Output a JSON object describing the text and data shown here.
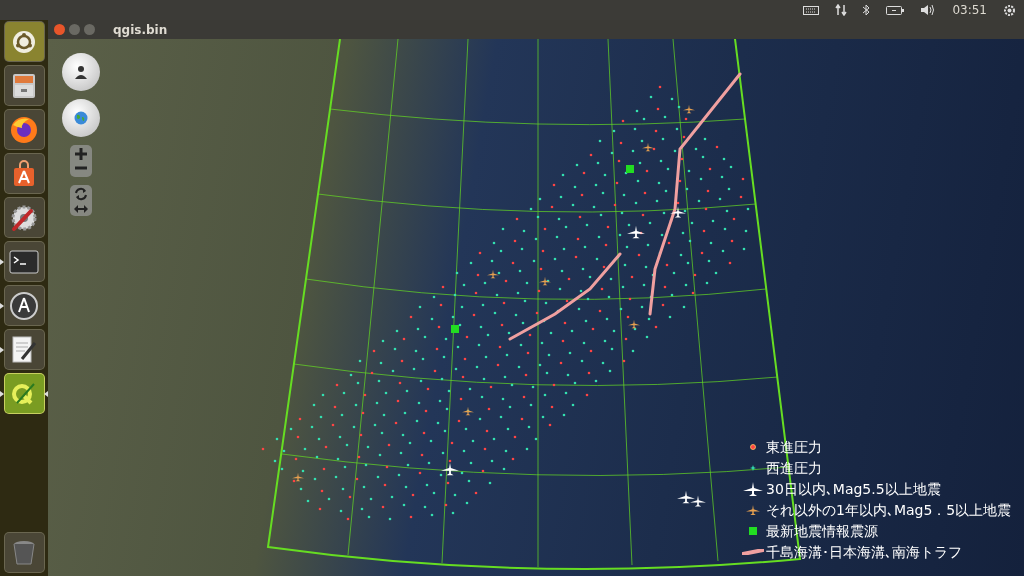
{
  "top_bar": {
    "clock": "03:51"
  },
  "launcher": {
    "items": [
      {
        "kind": "ubuntu",
        "running": false,
        "focused": false
      },
      {
        "kind": "files",
        "running": false,
        "focused": false
      },
      {
        "kind": "firefox",
        "running": false,
        "focused": false
      },
      {
        "kind": "store",
        "running": false,
        "focused": false
      },
      {
        "kind": "settings",
        "running": false,
        "focused": false
      },
      {
        "kind": "terminal",
        "running": true,
        "focused": false
      },
      {
        "kind": "updater",
        "running": true,
        "focused": false
      },
      {
        "kind": "editor",
        "running": true,
        "focused": false
      },
      {
        "kind": "qgis",
        "running": true,
        "focused": true
      },
      {
        "kind": "trash",
        "running": false,
        "focused": false
      }
    ]
  },
  "window": {
    "title": "qgis.bin"
  },
  "map": {
    "legend": [
      {
        "kind": "east_dot",
        "label": "東進圧力"
      },
      {
        "kind": "west_star",
        "label": "西進圧力"
      },
      {
        "kind": "white_plane",
        "label": "30日以内､Mag5.5以上地震"
      },
      {
        "kind": "orange_plane",
        "label": "それ以外の1年以内､Mag5．5以上地震"
      },
      {
        "kind": "green_square",
        "label": "最新地震情報震源"
      },
      {
        "kind": "trench_line",
        "label": "千島海溝･日本海溝､南海トラフ"
      }
    ]
  }
}
